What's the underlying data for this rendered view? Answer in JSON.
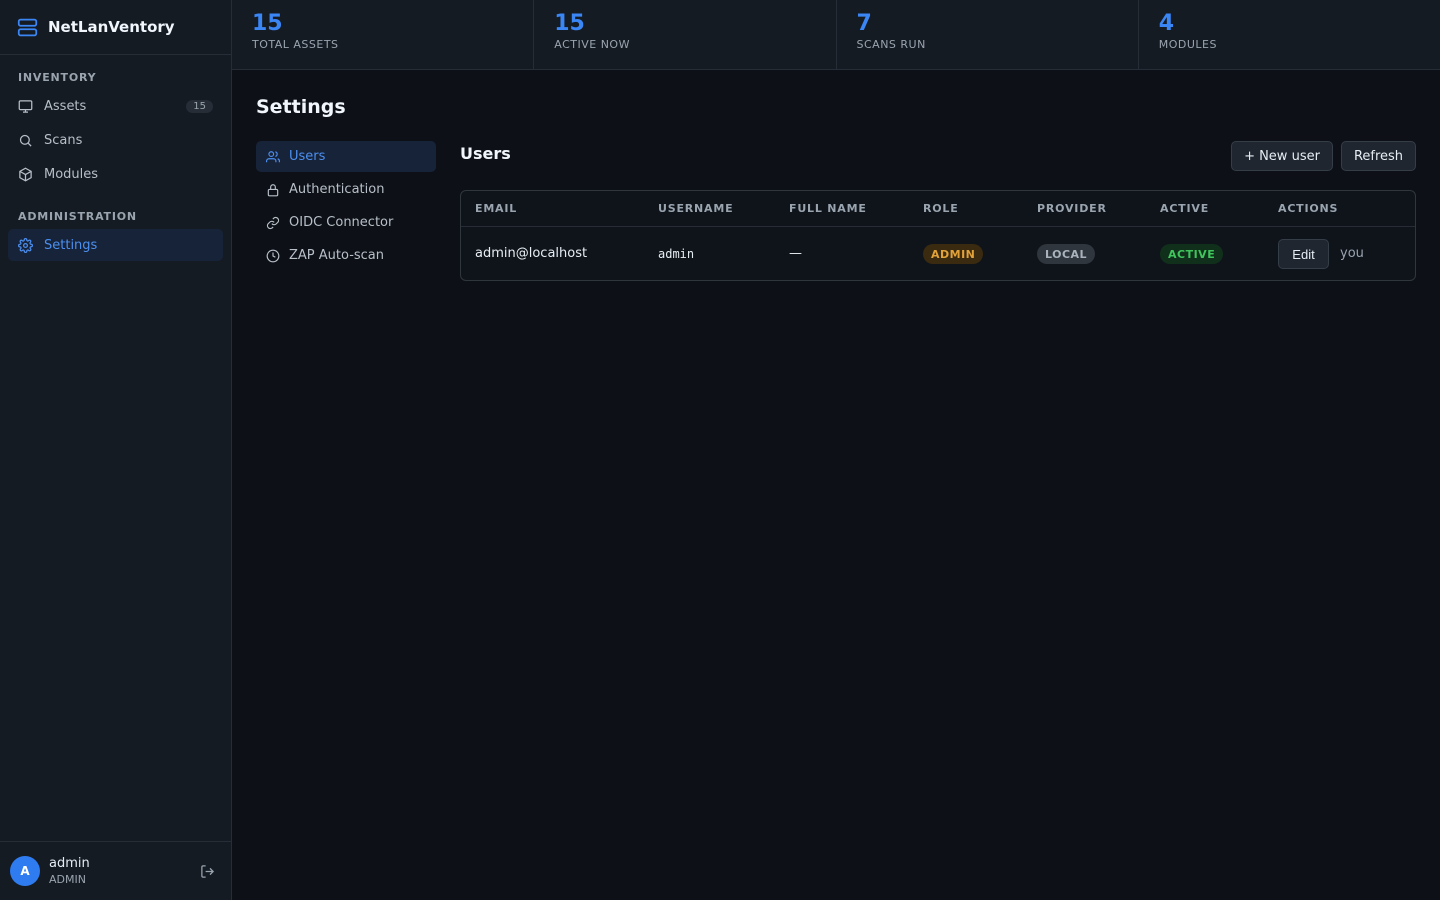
{
  "app": {
    "name": "NetLanVentory"
  },
  "sidebar": {
    "sections": [
      {
        "title": "INVENTORY"
      },
      {
        "title": "ADMINISTRATION"
      }
    ],
    "items": [
      {
        "label": "Assets",
        "icon": "monitor-icon",
        "badge": "15"
      },
      {
        "label": "Scans",
        "icon": "search-icon"
      },
      {
        "label": "Modules",
        "icon": "cube-icon"
      },
      {
        "label": "Settings",
        "icon": "gear-icon",
        "active": true
      }
    ],
    "user": {
      "initial": "A",
      "name": "admin",
      "role": "ADMIN"
    }
  },
  "stats": [
    {
      "value": "15",
      "label": "TOTAL ASSETS"
    },
    {
      "value": "15",
      "label": "ACTIVE NOW"
    },
    {
      "value": "7",
      "label": "SCANS RUN"
    },
    {
      "value": "4",
      "label": "MODULES"
    }
  ],
  "page": {
    "title": "Settings"
  },
  "settings_nav": [
    {
      "label": "Users",
      "icon": "users-icon",
      "active": true
    },
    {
      "label": "Authentication",
      "icon": "lock-icon"
    },
    {
      "label": "OIDC Connector",
      "icon": "link-icon"
    },
    {
      "label": "ZAP Auto-scan",
      "icon": "clock-icon"
    }
  ],
  "users": {
    "title": "Users",
    "new_user_label": "+ New user",
    "refresh_label": "Refresh",
    "columns": [
      "EMAIL",
      "USERNAME",
      "FULL NAME",
      "ROLE",
      "PROVIDER",
      "ACTIVE",
      "ACTIONS"
    ],
    "rows": [
      {
        "email": "admin@localhost",
        "username": "admin",
        "full_name": "—",
        "role": "ADMIN",
        "provider": "LOCAL",
        "active": "ACTIVE",
        "edit_label": "Edit",
        "note": "you"
      }
    ]
  },
  "colors": {
    "accent": "#3b86f5",
    "background": "#0d1117",
    "sidebar": "#151b23"
  }
}
